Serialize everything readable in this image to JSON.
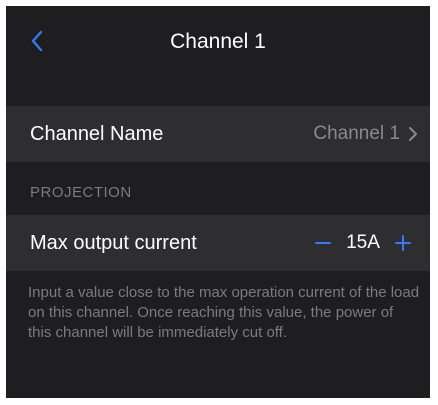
{
  "colors": {
    "background": "#1e1e20",
    "row_background": "#2e2e31",
    "accent": "#2f7cf6",
    "secondary_text": "#8a8a8e"
  },
  "nav": {
    "title": "Channel 1",
    "back_icon": "chevron-left-icon"
  },
  "channel_name_row": {
    "label": "Channel Name",
    "value": "Channel 1",
    "disclosure_icon": "chevron-right-icon"
  },
  "projection": {
    "section_header": "PROJECTION",
    "max_output_current": {
      "label": "Max output current",
      "value": "15A",
      "decrement_icon": "minus-icon",
      "increment_icon": "plus-icon"
    },
    "help_text": "Input a value close to the max operation current of the load on this channel. Once reaching this value, the power of this channel will be immediately cut off."
  }
}
